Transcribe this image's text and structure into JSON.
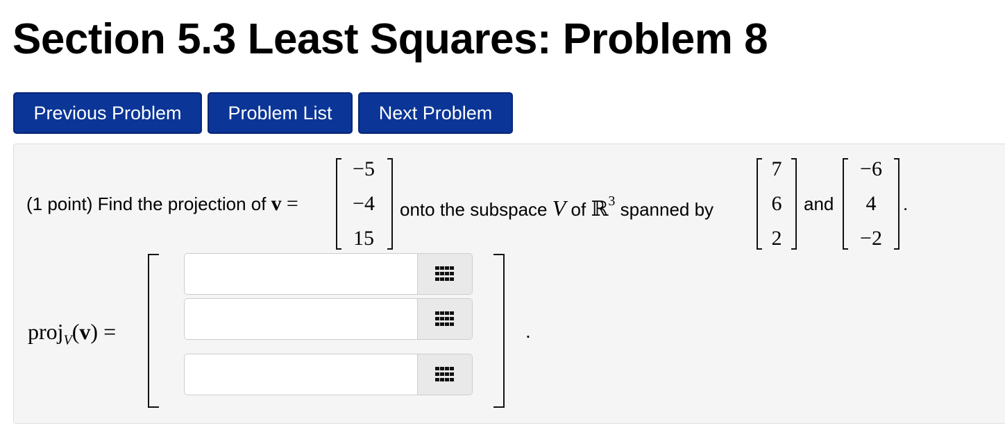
{
  "title": "Section 5.3 Least Squares: Problem 8",
  "nav": {
    "previous": "Previous Problem",
    "list": "Problem List",
    "next": "Next Problem"
  },
  "problem": {
    "points": "(1 point)",
    "text_find": "Find the projection of",
    "v_symbol": "v",
    "equals": "=",
    "vector_v": [
      "−5",
      "−4",
      "15"
    ],
    "text_onto": "onto the subspace",
    "subspace_symbol": "V",
    "text_of": "of",
    "space_symbol": "ℝ",
    "space_exponent": "3",
    "text_spanned": "spanned by",
    "basis_1": [
      "7",
      "6",
      "2"
    ],
    "text_and": "and",
    "basis_2": [
      "−6",
      "4",
      "−2"
    ],
    "period": "."
  },
  "answer": {
    "label_proj": "proj",
    "label_sub": "V",
    "label_open": "(",
    "label_v": "v",
    "label_close": ")",
    "label_eq": "=",
    "entries": [
      "",
      "",
      ""
    ],
    "period": ".",
    "button_icon": "grid-icon"
  }
}
